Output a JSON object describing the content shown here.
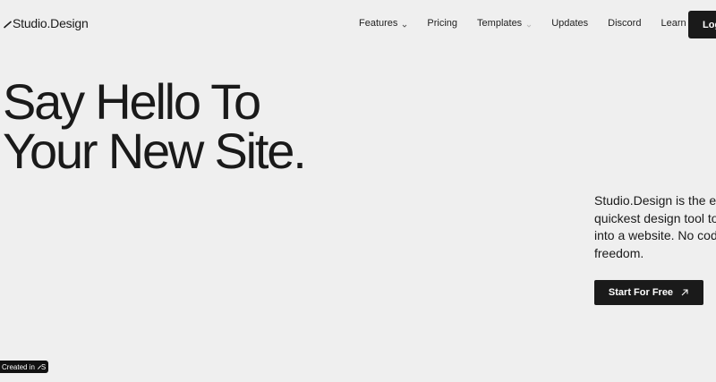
{
  "brand": {
    "name": "Studio.Design"
  },
  "nav": {
    "items": [
      {
        "label": "Features",
        "has_dropdown": true
      },
      {
        "label": "Pricing",
        "has_dropdown": false
      },
      {
        "label": "Templates",
        "has_dropdown": true
      },
      {
        "label": "Updates",
        "has_dropdown": false
      },
      {
        "label": "Discord",
        "has_dropdown": false
      },
      {
        "label": "Learn",
        "has_dropdown": false
      }
    ],
    "login_label": "Log"
  },
  "hero": {
    "title_line1": "Say Hello To",
    "title_line2": "Your New Site.",
    "desc_line1": "Studio.Design is the ea",
    "desc_line2": "quickest design tool to",
    "desc_line3": "into a website. No cod",
    "desc_line4": "freedom.",
    "cta_label": "Start For Free"
  },
  "badge": {
    "label": "Created in",
    "logo_text": "S"
  },
  "colors": {
    "background": "#efefef",
    "text": "#1a1a1a",
    "button_bg": "#1a1a1a",
    "button_text": "#ffffff"
  }
}
